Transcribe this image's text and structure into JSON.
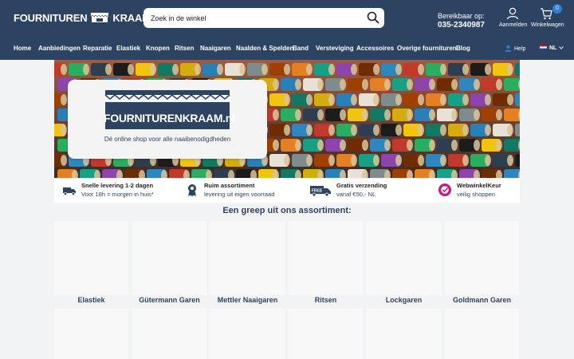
{
  "header": {
    "logo_left": "FOURNITUREN",
    "logo_right": "KRAAM",
    "search_placeholder": "Zoek in de winkel",
    "reach_label": "Bereikbaar op:",
    "reach_phone": "035-2340987",
    "account_label": "Aanmelden",
    "cart_label": "Winkelwagen",
    "cart_count": "0",
    "help_label": "Help",
    "lang_label": "NL"
  },
  "nav": {
    "items": [
      {
        "label": "Home"
      },
      {
        "label": "Aanbiedingen"
      },
      {
        "label": "Reparatie"
      },
      {
        "label": "Elastiek"
      },
      {
        "label": "Knopen"
      },
      {
        "label": "Ritsen"
      },
      {
        "label": "Naaigaren"
      },
      {
        "label": "Naalden & Spelden"
      },
      {
        "label": "Band"
      },
      {
        "label": "Versteviging"
      },
      {
        "label": "Accessoires"
      },
      {
        "label": "Overige fournituren"
      },
      {
        "label": "Blog"
      }
    ]
  },
  "hero": {
    "brand": "FOURNITURENKRAAM.nl",
    "tagline": "Dé online shop voor alle naaibenodigdheden"
  },
  "usps": [
    {
      "title": "Snelle levering 1-2 dagen",
      "subtitle": "Voor 18h = morgen in huis*",
      "icon": "truck-icon"
    },
    {
      "title": "Ruim assortiment",
      "subtitle": "levering uit eigen voorraad",
      "icon": "award-icon"
    },
    {
      "title": "Gratis verzending",
      "subtitle": "vanaf €50,- NL",
      "icon": "free-shipping-icon",
      "icon_text": "FREE"
    },
    {
      "title": "WebwinkelKeur",
      "subtitle": "veilig shoppen",
      "icon": "webwinkelkeur-icon"
    }
  ],
  "assortment": {
    "title": "Een greep uit ons assortiment:",
    "categories": [
      {
        "label": "Elastiek"
      },
      {
        "label": "Gütermann Garen"
      },
      {
        "label": "Mettler Naaigaren"
      },
      {
        "label": "Ritsen"
      },
      {
        "label": "Lockgaren"
      },
      {
        "label": "Goldmann Garen"
      }
    ]
  },
  "colors": {
    "brand_navy": "#2c4361",
    "accent_blue": "#2f7fd8",
    "usp_pink": "#c2198a"
  }
}
